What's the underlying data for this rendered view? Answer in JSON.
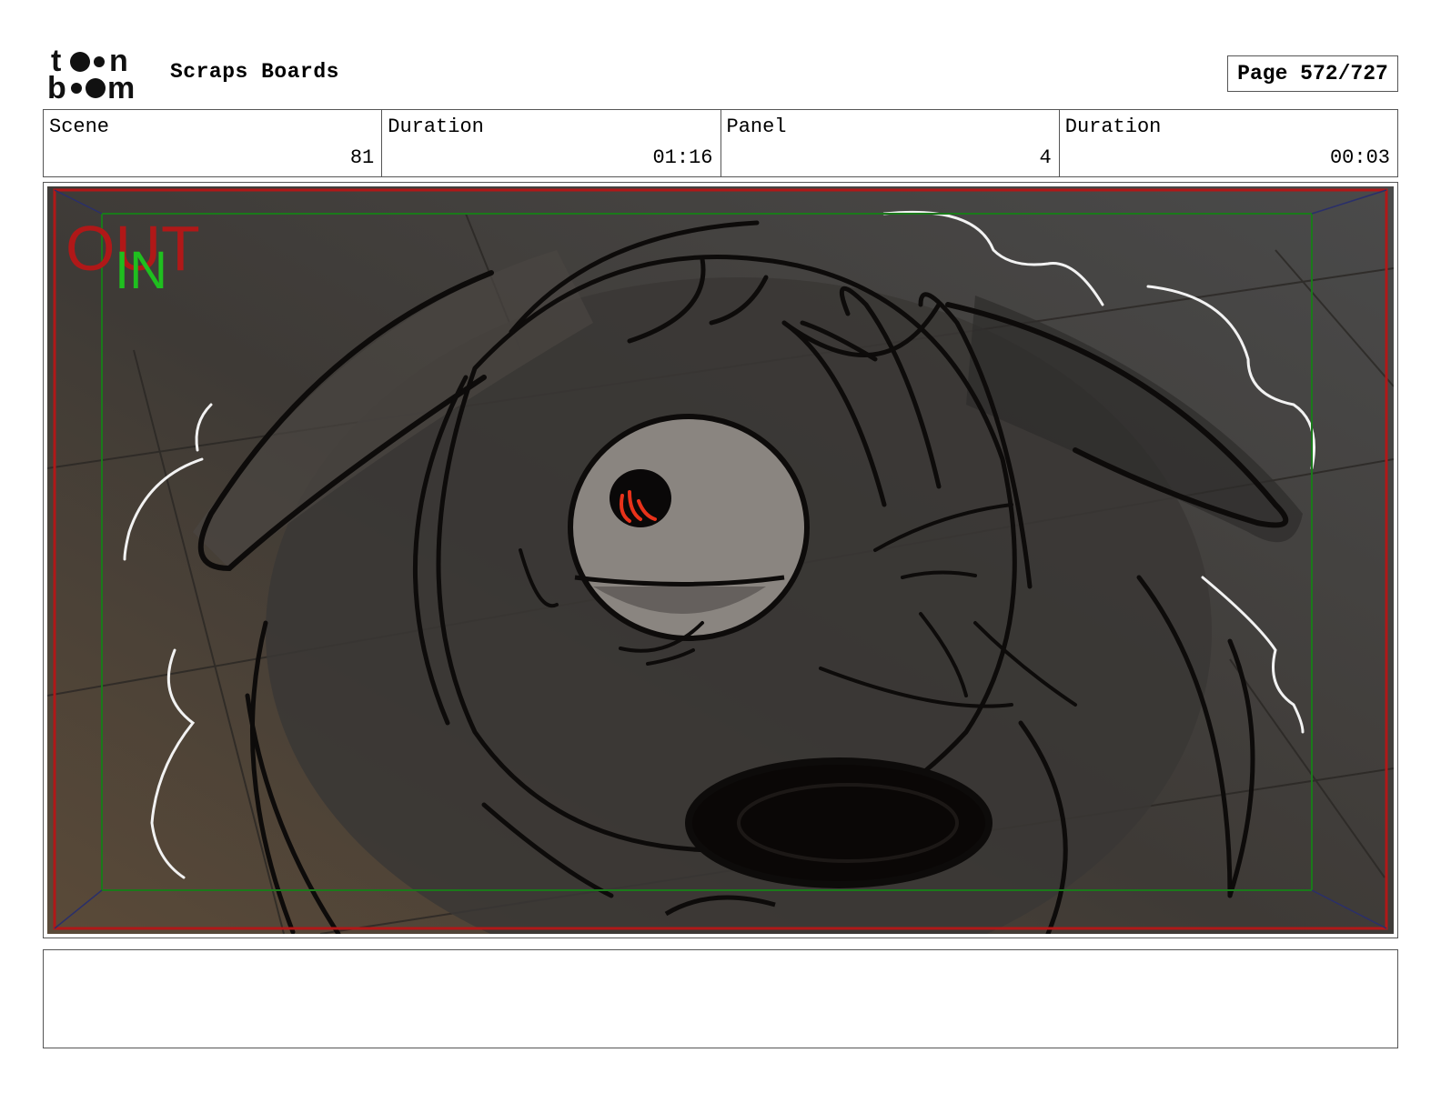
{
  "header": {
    "logo_text": "toon boom",
    "project_title": "Scraps Boards",
    "page_label": "Page 572/727"
  },
  "info": {
    "scene_label": "Scene",
    "scene_value": "81",
    "scene_duration_label": "Duration",
    "scene_duration_value": "01:16",
    "panel_label": "Panel",
    "panel_value": "4",
    "panel_duration_label": "Duration",
    "panel_duration_value": "00:03"
  },
  "panel": {
    "out_marker": "OUT",
    "in_marker": "IN",
    "colors": {
      "background": "#3c3a38",
      "out_frame": "#b01818",
      "in_frame": "#1a7a1a",
      "pupil": "#e8321a"
    }
  },
  "notes": {
    "text": ""
  }
}
